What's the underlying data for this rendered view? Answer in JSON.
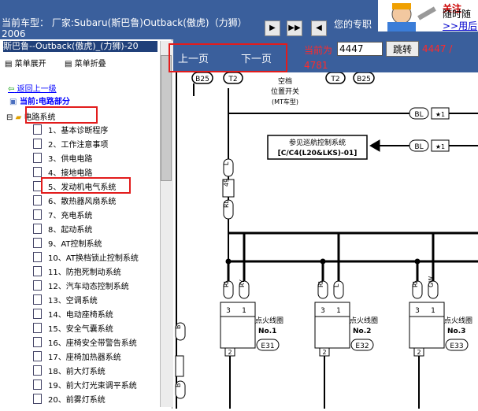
{
  "top": {
    "car_info": "当前车型： 厂家:Subaru(斯巴鲁)Outback(傲虎)（力狮）2006",
    "nav_icons": [
      "nav-forward-icon",
      "nav-fast-forward-icon",
      "nav-back-icon"
    ],
    "yours_label": "您的专职",
    "ad_line1": "关注",
    "ad_line2": "随时随",
    "ad_link": ">>用后"
  },
  "left": {
    "title": "斯巴鲁--Outback(傲虎)_(力狮)-20",
    "expand_label": "菜单展开",
    "collapse_label": "菜单折叠",
    "back_label": "返回上一级",
    "current_label": "当前:电路部分",
    "root_label": "电路系统",
    "items": [
      "1、基本诊断程序",
      "2、工作注意事项",
      "3、供电电路",
      "4、接地电路",
      "5、发动机电气系统",
      "6、散热器风扇系统",
      "7、充电系统",
      "8、起动系统",
      "9、AT控制系统",
      "10、AT换档锁止控制系统",
      "11、防抱死制动系统",
      "12、汽车动态控制系统",
      "13、空调系统",
      "14、电动座椅系统",
      "15、安全气囊系统",
      "16、座椅安全带警告系统",
      "17、座椅加热器系统",
      "18、前大灯系统",
      "19、前大灯光束调平系统",
      "20、前雾灯系统"
    ]
  },
  "pager": {
    "prev_label": "上一页",
    "next_label": "下一页",
    "current_label": "当前为",
    "page_value": "4447",
    "jump_label": "跳转",
    "total_a": "4447 /",
    "total_b": "4781"
  },
  "diagram": {
    "labels": {
      "b25": "B25",
      "t2": "T2",
      "switch": "空档",
      "switch2": "位置开关",
      "mt": "(MT车型)",
      "bl": "BL",
      "star": "★1",
      "see_line1": "参见巡航控制系统",
      "see_line2": "[C/C4(L20&LKS)-01]",
      "l": "L",
      "n49": "49",
      "rl": "RL",
      "ry": "RY",
      "gw": "GW",
      "b": "B",
      "n1": "1",
      "n2": "2",
      "n3": "3",
      "coil": "点火线圈",
      "no1": "No.1",
      "no2": "No.2",
      "no3": "No.3",
      "e31": "E31",
      "e32": "E32",
      "e33": "E33"
    }
  }
}
